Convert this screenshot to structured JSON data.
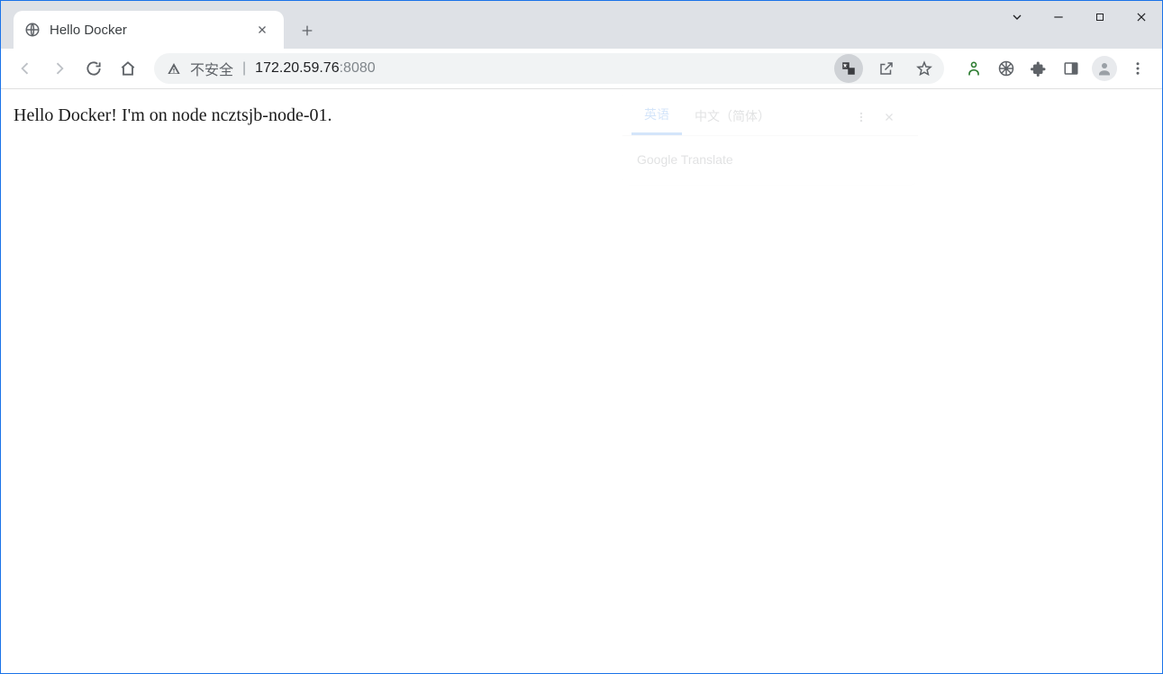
{
  "tab": {
    "title": "Hello Docker"
  },
  "omnibox": {
    "security_label": "不安全",
    "url_host": "172.20.59.76",
    "url_port": ":8080"
  },
  "page": {
    "body_text": "Hello Docker! I'm on node ncztsjb-node-01."
  },
  "translate_popup": {
    "tab_source": "英语",
    "tab_target": "中文（简体）",
    "body_label": "Google Translate"
  }
}
